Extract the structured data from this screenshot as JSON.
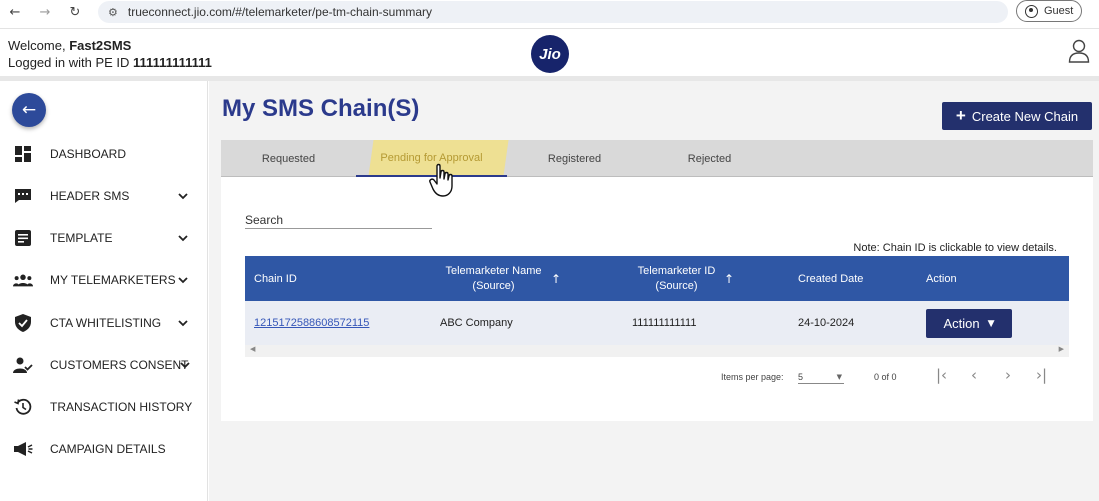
{
  "browser": {
    "back": "←",
    "forward": "→",
    "reload": "↻",
    "url": "trueconnect.jio.com/#/telemarketer/pe-tm-chain-summary",
    "profile_label": "Guest"
  },
  "header": {
    "welcome_prefix": "Welcome,",
    "welcome_name": "Fast2SMS",
    "login_prefix": "Logged in with PE ID",
    "pe_id": "111111111111",
    "logo_text": "Jio"
  },
  "sidebar": {
    "items": [
      {
        "label": "DASHBOARD",
        "icon": "dashboard-icon"
      },
      {
        "label": "HEADER SMS",
        "icon": "message-icon"
      },
      {
        "label": "TEMPLATE",
        "icon": "template-icon"
      },
      {
        "label": "MY TELEMARKETERS",
        "icon": "people-icon"
      },
      {
        "label": "CTA WHITELISTING",
        "icon": "shield-check-icon"
      },
      {
        "label": "CUSTOMERS CONSENT",
        "icon": "person-check-icon"
      },
      {
        "label": "TRANSACTION HISTORY",
        "icon": "history-icon"
      },
      {
        "label": "CAMPAIGN DETAILS",
        "icon": "megaphone-icon"
      }
    ]
  },
  "main": {
    "title": "My SMS Chain(S)",
    "create_label": "Create New Chain",
    "tabs": [
      "Requested",
      "Pending for Approval",
      "Registered",
      "Rejected"
    ],
    "active_tab": "Pending for Approval",
    "search_label": "Search",
    "note": "Note: Chain ID is clickable to view details."
  },
  "table": {
    "columns": [
      "Chain ID",
      "Telemarketer Name",
      "(Source)",
      "Telemarketer ID",
      "(Source)",
      "Created Date",
      "Action"
    ],
    "rows": [
      {
        "chain_id": "1215172588608572115",
        "tm_name": "ABC Company",
        "tm_id": "111111111111",
        "created": "24-10-2024",
        "action": "Action"
      }
    ]
  },
  "pager": {
    "items_label": "Items per page:",
    "page_size": "5",
    "range": "0 of 0"
  },
  "colors": {
    "brand": "#23306d",
    "table_header": "#2f57a5",
    "title": "#2b3a8c"
  }
}
